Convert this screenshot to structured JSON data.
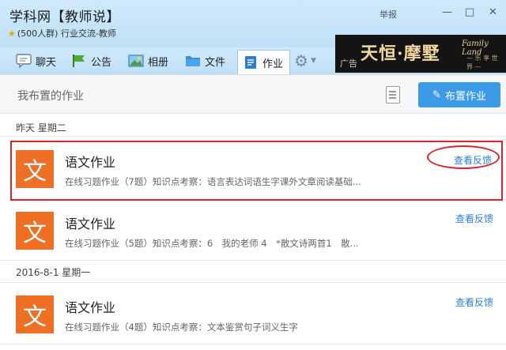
{
  "window": {
    "title": "学科网【教师说】",
    "subtitle": "(500人群) 行业交流-教师",
    "report_label": "举报",
    "minimize": "—",
    "maximize": "□",
    "close": "✕"
  },
  "toolbar": {
    "items": [
      {
        "label": "聊天",
        "icon": "chat-icon"
      },
      {
        "label": "公告",
        "icon": "flag-icon"
      },
      {
        "label": "相册",
        "icon": "photo-icon"
      },
      {
        "label": "文件",
        "icon": "folder-icon"
      },
      {
        "label": "作业",
        "icon": "homework-icon",
        "active": true
      }
    ],
    "settings_icon": "gear-icon"
  },
  "ad": {
    "label": "广告",
    "main_text": "天恒·摩墅",
    "brand_text": "Family Land",
    "sub_text": "— 乐 享 世 界 —"
  },
  "header": {
    "my_homework": "我布置的作业",
    "assign_button": "布置作业"
  },
  "groups": [
    {
      "date": "昨天 星期二",
      "items": [
        {
          "avatar": "文",
          "title": "语文作业",
          "desc": "在线习题作业（7题）知识点考察：语言表达词语生字课外文章阅读基础...",
          "action": "查看反馈",
          "highlighted": true
        }
      ]
    },
    {
      "date": "",
      "items": [
        {
          "avatar": "文",
          "title": "语文作业",
          "desc": "在线习题作业（5题）知识点考察：6　我的老师 4　*散文诗两首1　散...",
          "action": "查看反馈"
        }
      ]
    },
    {
      "date": "2016-8-1 星期一",
      "items": [
        {
          "avatar": "文",
          "title": "语文作业",
          "desc": "在线习题作业（4题）知识点考察：文本鉴赏句子词义生字",
          "action": "查看反馈"
        }
      ]
    }
  ],
  "colors": {
    "accent": "#3d9ae8",
    "avatar": "#ef7025",
    "highlight": "#d9252b",
    "link": "#2a7fd4"
  }
}
